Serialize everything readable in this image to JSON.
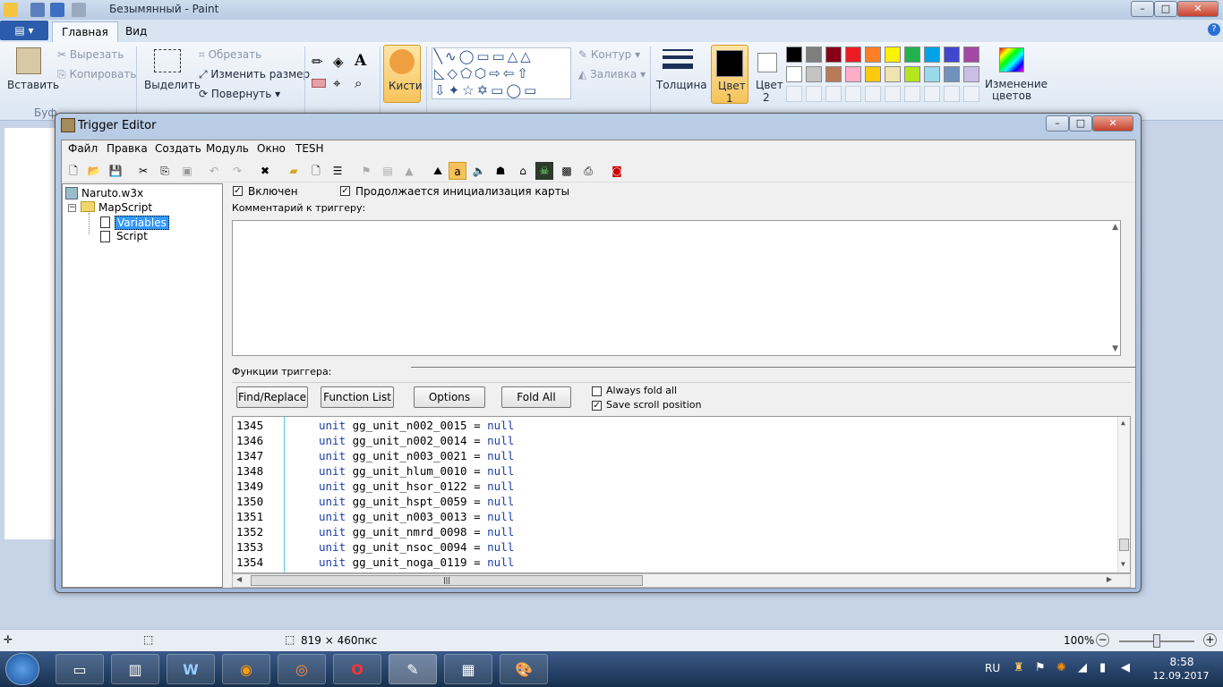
{
  "paint": {
    "title": "Безымянный - Paint",
    "tabs": [
      "Главная",
      "Вид"
    ],
    "file_menu_icon": "file-menu-icon",
    "clipboard": {
      "paste": "Вставить",
      "cut": "Вырезать",
      "copy": "Копировать",
      "group": "Буф"
    },
    "image": {
      "select": "Выделить",
      "crop": "Обрезать",
      "resize": "Изменить размер",
      "rotate": "Повернуть"
    },
    "brushes": "Кисти",
    "shapes": {
      "outline": "Контур",
      "fill": "Заливка"
    },
    "size": "Толщина",
    "color1": "Цвет\n1",
    "color1_a": "Цвет",
    "color1_b": "1",
    "color2_a": "Цвет",
    "color2_b": "2",
    "edit_colors_a": "Изменение",
    "edit_colors_b": "цветов",
    "palette_row1": [
      "#000000",
      "#7f7f7f",
      "#880015",
      "#ed1c24",
      "#ff7f27",
      "#fff200",
      "#22b14c",
      "#00a2e8",
      "#3f48cc",
      "#a349a4"
    ],
    "palette_row2": [
      "#ffffff",
      "#c3c3c3",
      "#b97a57",
      "#ffaec9",
      "#ffc90e",
      "#efe4b0",
      "#b5e61d",
      "#99d9ea",
      "#7092be",
      "#c8bfe7"
    ],
    "status": {
      "size": "819 × 460пкс",
      "zoom": "100%"
    }
  },
  "trigger_editor": {
    "title": "Trigger Editor",
    "menu": [
      "Файл",
      "Правка",
      "Создать",
      "Модуль",
      "Окно",
      "TESH"
    ],
    "tree": {
      "root": "Naruto.w3x",
      "folder": "MapScript",
      "items": [
        "Variables",
        "Script"
      ]
    },
    "enabled_label": "Включен",
    "init_label": "Продолжается инициализация карты",
    "comment_label": "Комментарий к триггеру:",
    "functions_label": "Функции триггера:",
    "buttons": {
      "find": "Find/Replace",
      "func_list": "Function List",
      "options": "Options",
      "fold_all": "Fold All"
    },
    "always_fold": "Always fold all",
    "save_scroll": "Save scroll position",
    "code_lines": [
      {
        "n": "1345",
        "name": "gg_unit_n002_0015"
      },
      {
        "n": "1346",
        "name": "gg_unit_n002_0014"
      },
      {
        "n": "1347",
        "name": "gg_unit_n003_0021"
      },
      {
        "n": "1348",
        "name": "gg_unit_hlum_0010"
      },
      {
        "n": "1349",
        "name": "gg_unit_hsor_0122"
      },
      {
        "n": "1350",
        "name": "gg_unit_hspt_0059"
      },
      {
        "n": "1351",
        "name": "gg_unit_n003_0013"
      },
      {
        "n": "1352",
        "name": "gg_unit_nmrd_0098"
      },
      {
        "n": "1353",
        "name": "gg_unit_nsoc_0094"
      },
      {
        "n": "1354",
        "name": "gg_unit_noga_0119"
      }
    ],
    "kw_unit": "unit",
    "kw_null": "null"
  },
  "taskbar": {
    "lang": "RU",
    "time": "8:58",
    "date": "12.09.2017"
  }
}
